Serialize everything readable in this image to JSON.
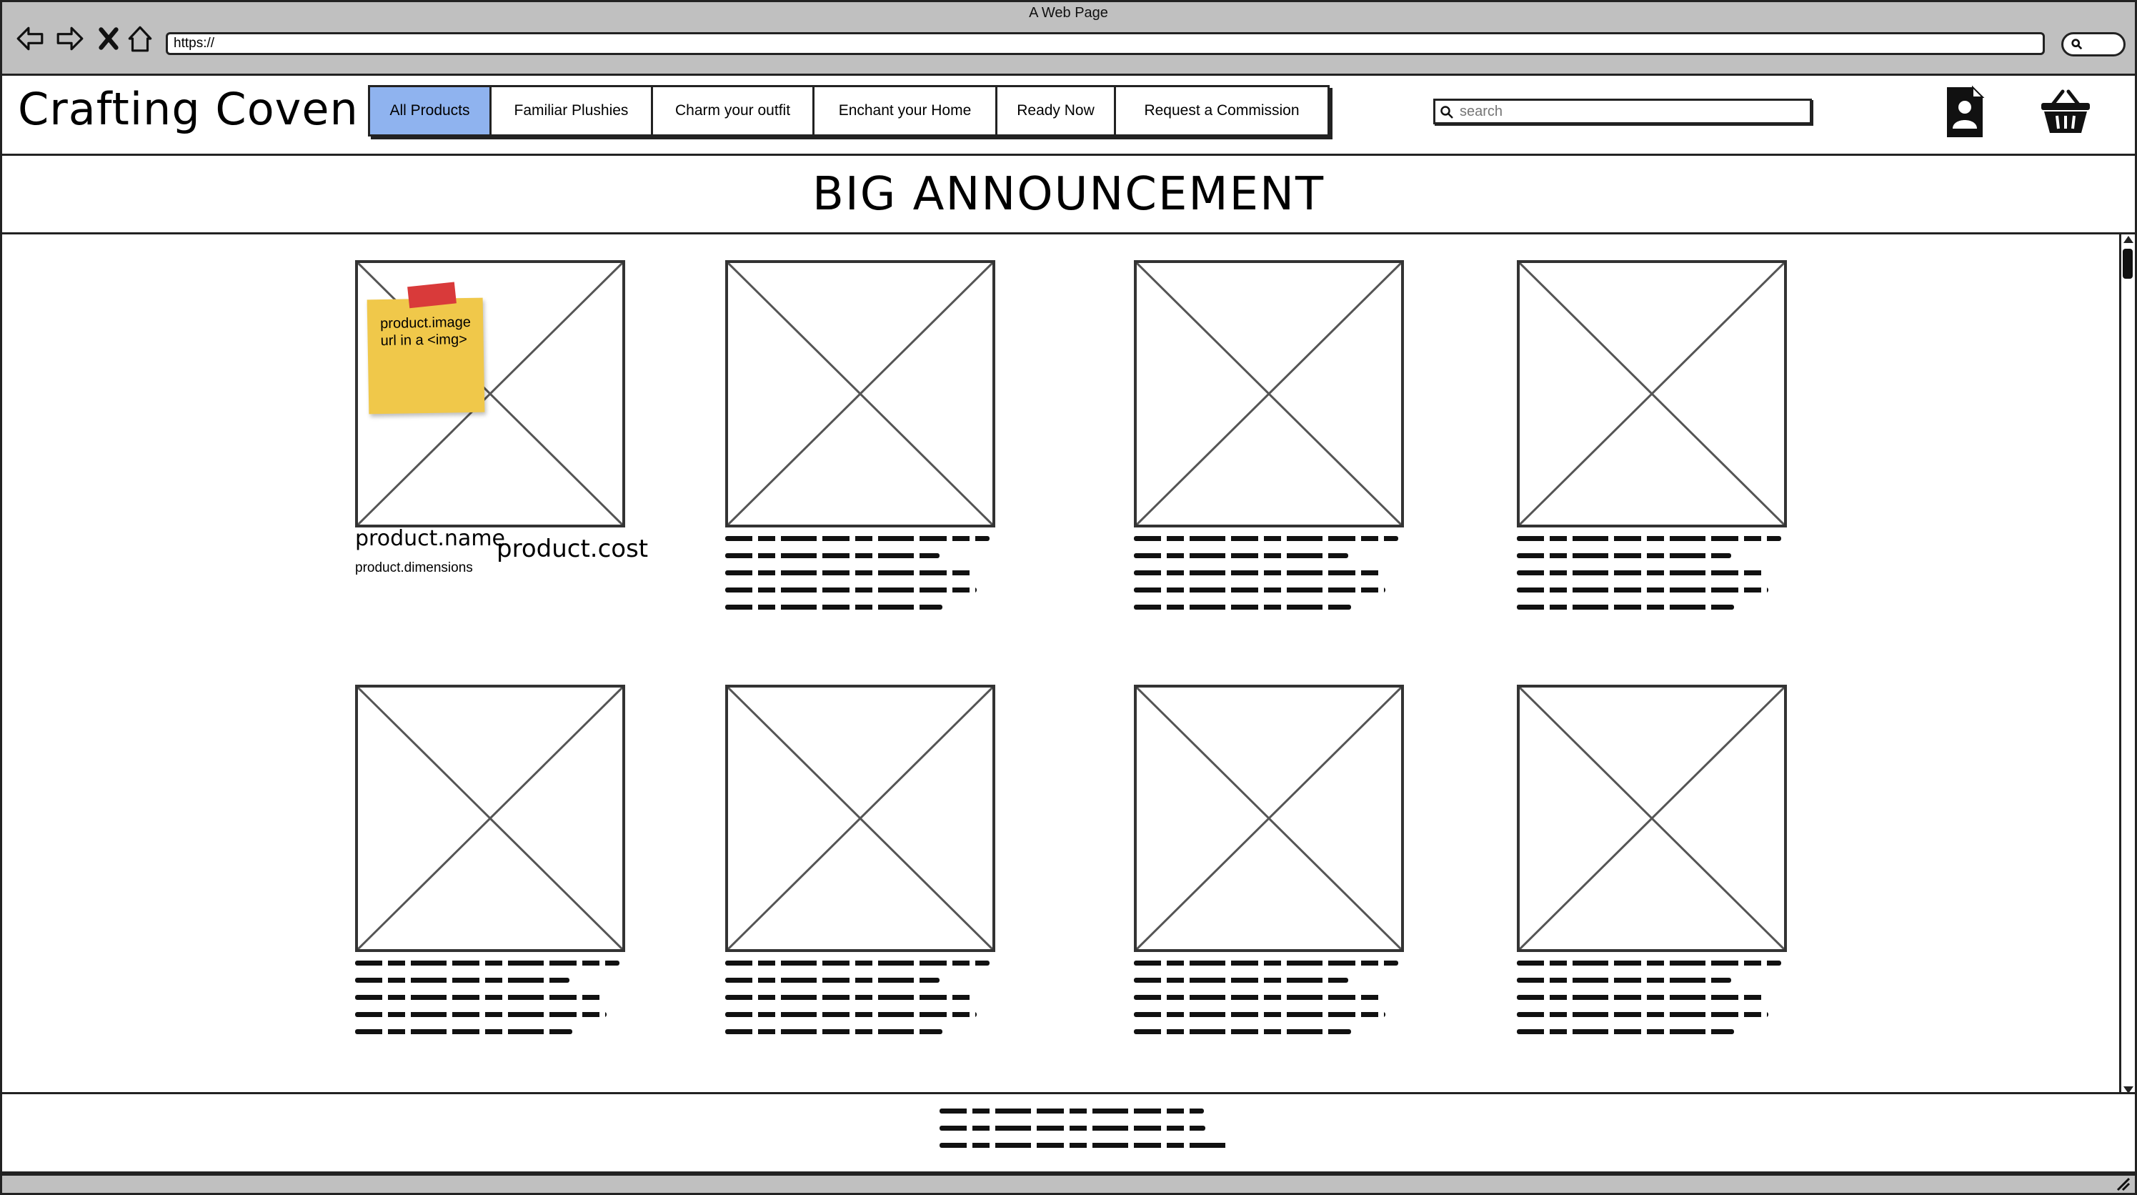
{
  "window": {
    "title": "A Web Page",
    "url": "https://"
  },
  "site": {
    "logo": "Crafting Coven",
    "nav": [
      "All Products",
      "Familiar Plushies",
      "Charm your outfit",
      "Enchant your Home",
      "Ready Now",
      "Request a Commission"
    ],
    "active_nav": "All Products",
    "search_placeholder": "search"
  },
  "announcement": "BIG ANNOUNCEMENT",
  "first_card": {
    "name": "product.name",
    "dimensions": "product.dimensions",
    "cost": "product.cost",
    "sticky_note": "product.image url in a <img>"
  },
  "colors": {
    "active_tab": "#8fb3ef",
    "sticky": "#f0c84a",
    "tape": "#d93a3a",
    "chrome": "#c0c0c0"
  },
  "icons": [
    "back-arrow-icon",
    "forward-arrow-icon",
    "close-x-icon",
    "home-icon",
    "account-icon",
    "basket-icon",
    "search-icon"
  ]
}
